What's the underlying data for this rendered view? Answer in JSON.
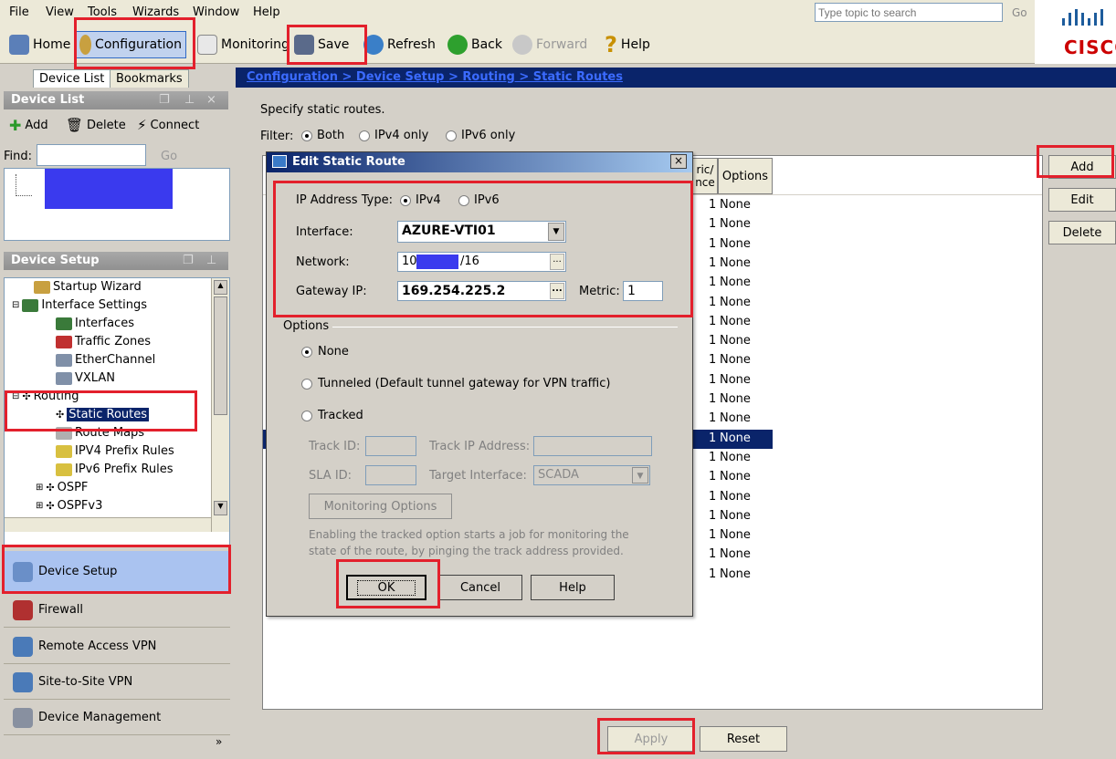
{
  "menu": [
    "File",
    "View",
    "Tools",
    "Wizards",
    "Window",
    "Help"
  ],
  "search": {
    "placeholder": "Type topic to search",
    "go": "Go"
  },
  "brand": {
    "logo_text": "CISCO"
  },
  "toolbar": {
    "home": "Home",
    "configuration": "Configuration",
    "monitoring": "Monitoring",
    "save": "Save",
    "refresh": "Refresh",
    "back": "Back",
    "forward": "Forward",
    "help": "Help"
  },
  "left_tabs": {
    "device_list": "Device List",
    "bookmarks": "Bookmarks"
  },
  "device_list": {
    "header": "Device List",
    "add": "Add",
    "delete": "Delete",
    "connect": "Connect",
    "find_label": "Find:",
    "go": "Go"
  },
  "device_setup": {
    "header": "Device Setup",
    "tree": [
      {
        "label": "Startup Wizard"
      },
      {
        "label": "Interface Settings"
      },
      {
        "label": "Interfaces"
      },
      {
        "label": "Traffic Zones"
      },
      {
        "label": "EtherChannel"
      },
      {
        "label": "VXLAN"
      },
      {
        "label": "Routing"
      },
      {
        "label": "Static Routes"
      },
      {
        "label": "Route Maps"
      },
      {
        "label": "IPV4 Prefix Rules"
      },
      {
        "label": "IPv6 Prefix Rules"
      },
      {
        "label": "OSPF"
      },
      {
        "label": "OSPFv3"
      }
    ]
  },
  "nav": [
    "Device Setup",
    "Firewall",
    "Remote Access VPN",
    "Site-to-Site VPN",
    "Device Management"
  ],
  "breadcrumb": "Configuration > Device Setup > Routing > Static Routes",
  "main": {
    "intro": "Specify static routes.",
    "filter_label": "Filter:",
    "filter_options": [
      "Both",
      "IPv4 only",
      "IPv6 only"
    ],
    "filter_selected": "Both",
    "columns": {
      "metric_partial": "ric/\nnce",
      "options": "Options"
    },
    "rows": [
      {
        "metric": "1",
        "options": "None"
      },
      {
        "metric": "1",
        "options": "None"
      },
      {
        "metric": "1",
        "options": "None"
      },
      {
        "metric": "1",
        "options": "None"
      },
      {
        "metric": "1",
        "options": "None"
      },
      {
        "metric": "1",
        "options": "None"
      },
      {
        "metric": "1",
        "options": "None"
      },
      {
        "metric": "1",
        "options": "None"
      },
      {
        "metric": "1",
        "options": "None"
      },
      {
        "metric": "1",
        "options": "None"
      },
      {
        "metric": "1",
        "options": "None"
      },
      {
        "metric": "1",
        "options": "None"
      },
      {
        "metric": "1",
        "options": "None"
      },
      {
        "metric": "1",
        "options": "None"
      },
      {
        "metric": "1",
        "options": "None"
      },
      {
        "metric": "1",
        "options": "None"
      },
      {
        "metric": "1",
        "options": "None"
      },
      {
        "metric": "1",
        "options": "None"
      },
      {
        "metric": "1",
        "options": "None"
      },
      {
        "metric": "1",
        "options": "None"
      }
    ],
    "selected_row": 12,
    "side_buttons": {
      "add": "Add",
      "edit": "Edit",
      "delete": "Delete"
    },
    "apply": "Apply",
    "reset": "Reset"
  },
  "dialog": {
    "title": "Edit Static Route",
    "ip_type_label": "IP Address Type:",
    "ip_type_options": [
      "IPv4",
      "IPv6"
    ],
    "ip_type_selected": "IPv4",
    "interface_label": "Interface:",
    "interface_value": "AZURE-VTI01",
    "network_label": "Network:",
    "network_prefix": "10",
    "network_suffix": "/16",
    "gateway_label": "Gateway IP:",
    "gateway_value": "169.254.225.2",
    "metric_label": "Metric:",
    "metric_value": "1",
    "options_group": "Options",
    "opt_none": "None",
    "opt_tunneled": "Tunneled (Default tunnel gateway for VPN traffic)",
    "opt_tracked": "Tracked",
    "track_id_label": "Track ID:",
    "track_ip_label": "Track IP Address:",
    "sla_id_label": "SLA ID:",
    "target_if_label": "Target Interface:",
    "target_if_value": "SCADA",
    "monitoring_options": "Monitoring Options",
    "help_text": "Enabling the tracked option starts a job for monitoring the state of the route, by pinging the track address provided.",
    "ok": "OK",
    "cancel": "Cancel",
    "help": "Help",
    "close": "×"
  },
  "colors": {
    "highlight": "#e3202c",
    "selection": "#0a246a",
    "redact": "#3a3aee"
  }
}
